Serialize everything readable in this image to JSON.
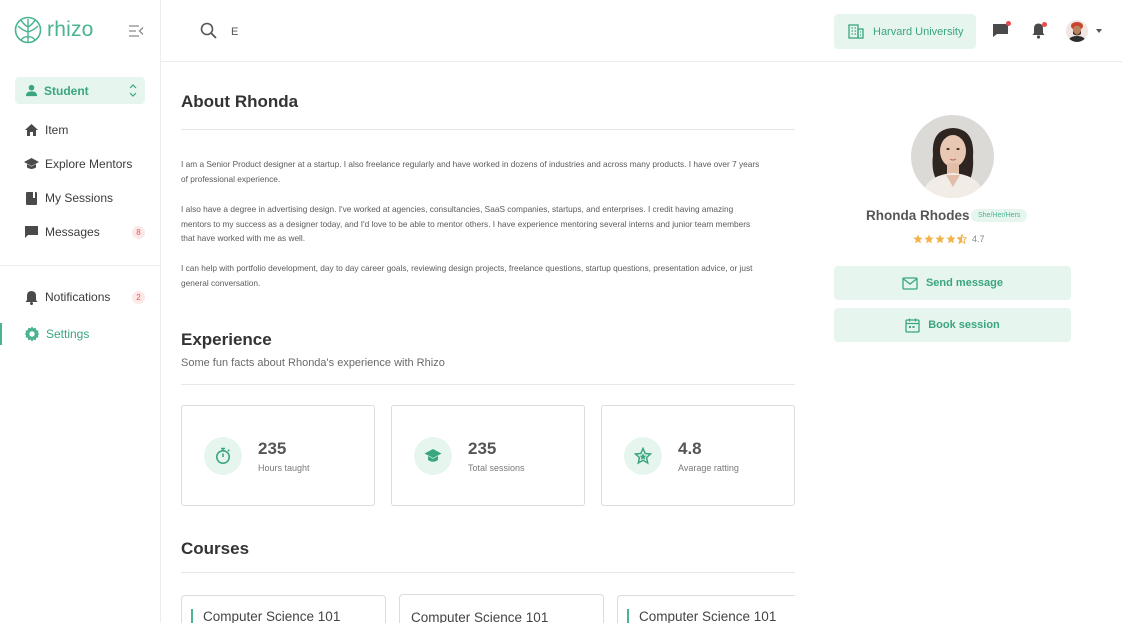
{
  "brand": {
    "name": "rhizo",
    "accent": "#4ab391"
  },
  "sidebar": {
    "role": "Student",
    "items": [
      {
        "label": "Item",
        "icon": "home-icon"
      },
      {
        "label": "Explore Mentors",
        "icon": "graduation-cap-icon"
      },
      {
        "label": "My Sessions",
        "icon": "book-icon"
      },
      {
        "label": "Messages",
        "icon": "message-icon",
        "badge": "8"
      },
      {
        "label": "Notifications",
        "icon": "bell-icon",
        "badge": "2"
      },
      {
        "label": "Settings",
        "icon": "gear-icon",
        "active": true
      }
    ]
  },
  "topbar": {
    "search_value": "E",
    "university": "Harvard University"
  },
  "about": {
    "title": "About Rhonda",
    "paragraphs": [
      "I am a Senior Product designer at a startup. I also freelance regularly and have worked in dozens of industries and across many products. I have over 7 years of professional experience.",
      "I also have a degree in advertising design. I've worked at agencies, consultancies, SaaS companies, startups, and enterprises. I credit having amazing mentors to my success as a designer today, and I'd love to be able to mentor others. I have experience mentoring several interns and junior team members that have worked with me as well.",
      "I can help with portfolio development, day to day career goals, reviewing design projects, freelance questions, startup questions, presentation advice, or just general conversation."
    ]
  },
  "experience": {
    "title": "Experience",
    "subtitle": "Some fun facts about Rhonda's experience with Rhizo",
    "stats": [
      {
        "value": "235",
        "label": "Hours taught",
        "icon": "stopwatch-icon"
      },
      {
        "value": "235",
        "label": "Total sessions",
        "icon": "graduation-cap-icon"
      },
      {
        "value": "4.8",
        "label": "Avarage ratting",
        "icon": "star-badge-icon"
      }
    ]
  },
  "courses": {
    "title": "Courses",
    "items": [
      {
        "title": "Computer Science 101"
      },
      {
        "title": "Computer Science 101"
      },
      {
        "title": "Computer Science 101"
      }
    ]
  },
  "profile": {
    "name": "Rhonda Rhodes",
    "pronouns": "She/Her/Hers",
    "rating": "4.7",
    "rating_value": 4.5,
    "send_message": "Send message",
    "book_session": "Book session"
  }
}
